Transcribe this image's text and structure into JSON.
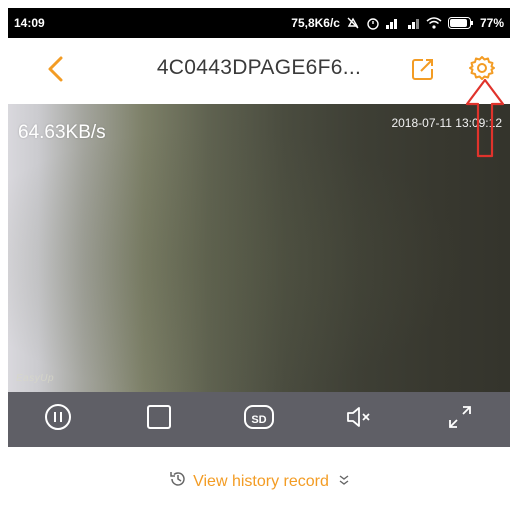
{
  "status_bar": {
    "time": "14:09",
    "speed": "75,8K6/c",
    "battery": "77%"
  },
  "header": {
    "title": "4C0443DPAGE6F6..."
  },
  "video": {
    "bitrate": "64.63KB/s",
    "timestamp": "2018-07-11 13:09:12",
    "watermark": "EasyUp"
  },
  "controls": {
    "sd_label": "SD"
  },
  "history": {
    "label": "View history record"
  },
  "colors": {
    "accent": "#f39c24",
    "annotation": "#e0332c",
    "toolbar": "#5f5f66"
  }
}
